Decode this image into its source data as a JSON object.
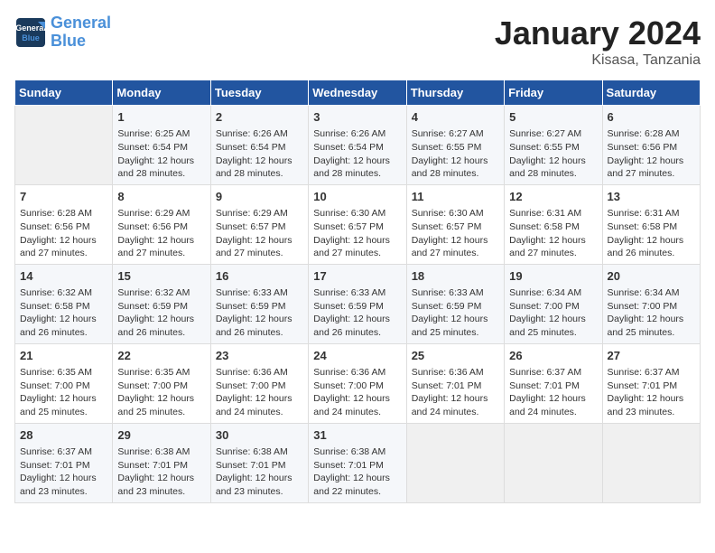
{
  "logo": {
    "line1": "General",
    "line2": "Blue"
  },
  "title": "January 2024",
  "location": "Kisasa, Tanzania",
  "days_of_week": [
    "Sunday",
    "Monday",
    "Tuesday",
    "Wednesday",
    "Thursday",
    "Friday",
    "Saturday"
  ],
  "weeks": [
    [
      {
        "day": "",
        "content": ""
      },
      {
        "day": "1",
        "content": "Sunrise: 6:25 AM\nSunset: 6:54 PM\nDaylight: 12 hours\nand 28 minutes."
      },
      {
        "day": "2",
        "content": "Sunrise: 6:26 AM\nSunset: 6:54 PM\nDaylight: 12 hours\nand 28 minutes."
      },
      {
        "day": "3",
        "content": "Sunrise: 6:26 AM\nSunset: 6:54 PM\nDaylight: 12 hours\nand 28 minutes."
      },
      {
        "day": "4",
        "content": "Sunrise: 6:27 AM\nSunset: 6:55 PM\nDaylight: 12 hours\nand 28 minutes."
      },
      {
        "day": "5",
        "content": "Sunrise: 6:27 AM\nSunset: 6:55 PM\nDaylight: 12 hours\nand 28 minutes."
      },
      {
        "day": "6",
        "content": "Sunrise: 6:28 AM\nSunset: 6:56 PM\nDaylight: 12 hours\nand 27 minutes."
      }
    ],
    [
      {
        "day": "7",
        "content": "Sunrise: 6:28 AM\nSunset: 6:56 PM\nDaylight: 12 hours\nand 27 minutes."
      },
      {
        "day": "8",
        "content": "Sunrise: 6:29 AM\nSunset: 6:56 PM\nDaylight: 12 hours\nand 27 minutes."
      },
      {
        "day": "9",
        "content": "Sunrise: 6:29 AM\nSunset: 6:57 PM\nDaylight: 12 hours\nand 27 minutes."
      },
      {
        "day": "10",
        "content": "Sunrise: 6:30 AM\nSunset: 6:57 PM\nDaylight: 12 hours\nand 27 minutes."
      },
      {
        "day": "11",
        "content": "Sunrise: 6:30 AM\nSunset: 6:57 PM\nDaylight: 12 hours\nand 27 minutes."
      },
      {
        "day": "12",
        "content": "Sunrise: 6:31 AM\nSunset: 6:58 PM\nDaylight: 12 hours\nand 27 minutes."
      },
      {
        "day": "13",
        "content": "Sunrise: 6:31 AM\nSunset: 6:58 PM\nDaylight: 12 hours\nand 26 minutes."
      }
    ],
    [
      {
        "day": "14",
        "content": "Sunrise: 6:32 AM\nSunset: 6:58 PM\nDaylight: 12 hours\nand 26 minutes."
      },
      {
        "day": "15",
        "content": "Sunrise: 6:32 AM\nSunset: 6:59 PM\nDaylight: 12 hours\nand 26 minutes."
      },
      {
        "day": "16",
        "content": "Sunrise: 6:33 AM\nSunset: 6:59 PM\nDaylight: 12 hours\nand 26 minutes."
      },
      {
        "day": "17",
        "content": "Sunrise: 6:33 AM\nSunset: 6:59 PM\nDaylight: 12 hours\nand 26 minutes."
      },
      {
        "day": "18",
        "content": "Sunrise: 6:33 AM\nSunset: 6:59 PM\nDaylight: 12 hours\nand 25 minutes."
      },
      {
        "day": "19",
        "content": "Sunrise: 6:34 AM\nSunset: 7:00 PM\nDaylight: 12 hours\nand 25 minutes."
      },
      {
        "day": "20",
        "content": "Sunrise: 6:34 AM\nSunset: 7:00 PM\nDaylight: 12 hours\nand 25 minutes."
      }
    ],
    [
      {
        "day": "21",
        "content": "Sunrise: 6:35 AM\nSunset: 7:00 PM\nDaylight: 12 hours\nand 25 minutes."
      },
      {
        "day": "22",
        "content": "Sunrise: 6:35 AM\nSunset: 7:00 PM\nDaylight: 12 hours\nand 25 minutes."
      },
      {
        "day": "23",
        "content": "Sunrise: 6:36 AM\nSunset: 7:00 PM\nDaylight: 12 hours\nand 24 minutes."
      },
      {
        "day": "24",
        "content": "Sunrise: 6:36 AM\nSunset: 7:00 PM\nDaylight: 12 hours\nand 24 minutes."
      },
      {
        "day": "25",
        "content": "Sunrise: 6:36 AM\nSunset: 7:01 PM\nDaylight: 12 hours\nand 24 minutes."
      },
      {
        "day": "26",
        "content": "Sunrise: 6:37 AM\nSunset: 7:01 PM\nDaylight: 12 hours\nand 24 minutes."
      },
      {
        "day": "27",
        "content": "Sunrise: 6:37 AM\nSunset: 7:01 PM\nDaylight: 12 hours\nand 23 minutes."
      }
    ],
    [
      {
        "day": "28",
        "content": "Sunrise: 6:37 AM\nSunset: 7:01 PM\nDaylight: 12 hours\nand 23 minutes."
      },
      {
        "day": "29",
        "content": "Sunrise: 6:38 AM\nSunset: 7:01 PM\nDaylight: 12 hours\nand 23 minutes."
      },
      {
        "day": "30",
        "content": "Sunrise: 6:38 AM\nSunset: 7:01 PM\nDaylight: 12 hours\nand 23 minutes."
      },
      {
        "day": "31",
        "content": "Sunrise: 6:38 AM\nSunset: 7:01 PM\nDaylight: 12 hours\nand 22 minutes."
      },
      {
        "day": "",
        "content": ""
      },
      {
        "day": "",
        "content": ""
      },
      {
        "day": "",
        "content": ""
      }
    ]
  ]
}
